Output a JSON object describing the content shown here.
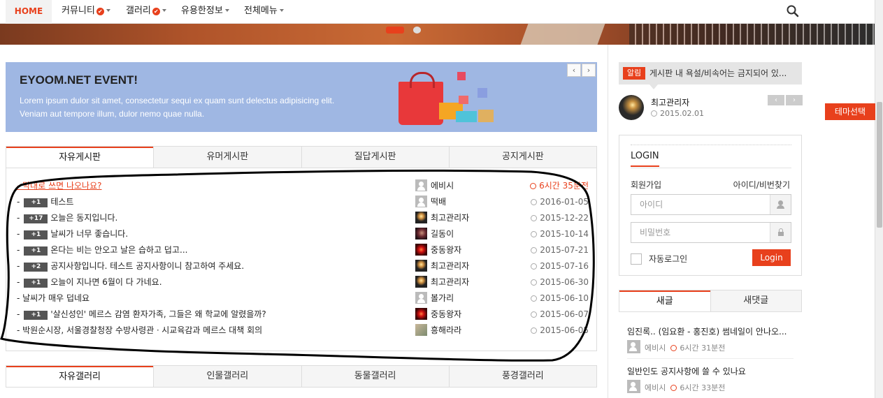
{
  "nav": {
    "home": "HOME",
    "items": [
      {
        "label": "커뮤니티",
        "check": true
      },
      {
        "label": "갤러리",
        "check": true
      },
      {
        "label": "유용한정보",
        "check": false
      },
      {
        "label": "전체메뉴",
        "check": false
      }
    ]
  },
  "event": {
    "title": "EYOOM.NET EVENT!",
    "desc1": "Lorem ipsum dulor sit amet, consectetur sequi ex quam sunt delectus adipisicing elit.",
    "desc2": "Veniam aut tempore illum, dulor nemo quae nulla.",
    "prev": "‹",
    "next": "›"
  },
  "board_tabs": [
    "자유게시판",
    "유머게시판",
    "질답게시판",
    "공지게시판"
  ],
  "posts": [
    {
      "subject": "- 막대로 쓰면 나오나요?",
      "badge": "",
      "author": "에비시",
      "avatar": "user",
      "date": "6시간 35분전",
      "hot": true
    },
    {
      "subject": "테스트",
      "badge": "+1",
      "author": "떡배",
      "avatar": "user",
      "date": "2016-01-05",
      "hot": false
    },
    {
      "subject": "오늘은 동지입니다.",
      "badge": "+17",
      "author": "최고관리자",
      "avatar": "candle",
      "date": "2015-12-22",
      "hot": false
    },
    {
      "subject": "날씨가 너무 좋습니다.",
      "badge": "+1",
      "author": "길동이",
      "avatar": "girl",
      "date": "2015-10-14",
      "hot": false
    },
    {
      "subject": "온다는 비는 안오고 날은 습하고 덥고...",
      "badge": "+1",
      "author": "중동왕자",
      "avatar": "spark",
      "date": "2015-07-21",
      "hot": false
    },
    {
      "subject": "공지사항입니다. 테스트 공지사항이니 참고하여 주세요.",
      "badge": "+2",
      "author": "최고관리자",
      "avatar": "candle",
      "date": "2015-07-16",
      "hot": false
    },
    {
      "subject": "오늘이 지나면 6월이 다 가네요.",
      "badge": "+1",
      "author": "최고관리자",
      "avatar": "candle",
      "date": "2015-06-30",
      "hot": false
    },
    {
      "subject": "- 날씨가 매우 덥네요",
      "badge": "",
      "author": "볼가리",
      "avatar": "user",
      "date": "2015-06-10",
      "hot": false
    },
    {
      "subject": "'살신성인' 메르스 감염 환자가족, 그들은 왜 학교에 알렸을까?",
      "badge": "+1",
      "author": "중동왕자",
      "avatar": "spark",
      "date": "2015-06-07",
      "hot": false
    },
    {
      "subject": "- 박원순시장, 서울경찰청장 수방사령관ㆍ시교육감과 메르스 대책 회의",
      "badge": "",
      "author": "흥해라라",
      "avatar": "photo",
      "date": "2015-06-05",
      "hot": false
    }
  ],
  "gallery_tabs": [
    "자유갤러리",
    "인물갤러리",
    "동물갤러리",
    "풍경갤러리"
  ],
  "notice": {
    "tag": "알림",
    "text": "게시판 내 욕설/비속어는 금지되어 있..."
  },
  "admin": {
    "name": "최고관리자",
    "date": "2015.02.01"
  },
  "theme_button": "테마선택",
  "login": {
    "title": "LOGIN",
    "join": "회원가입",
    "find": "아이디/비번찾기",
    "id_placeholder": "아이디",
    "pw_placeholder": "비밀번호",
    "auto": "자동로그인",
    "button": "Login"
  },
  "side_tabs": [
    "새글",
    "새댓글"
  ],
  "side_posts": [
    {
      "title": "임진록.. (임요환 - 홍진호) 썸네일이 안나오...",
      "author": "에비시",
      "time": "6시간 31분전"
    },
    {
      "title": "일반인도 공지사항에 쓸 수 있나요",
      "author": "에비시",
      "time": "6시간 33분전"
    }
  ],
  "colors": {
    "accent": "#e8401c",
    "event_bg": "#9fb7e3"
  }
}
